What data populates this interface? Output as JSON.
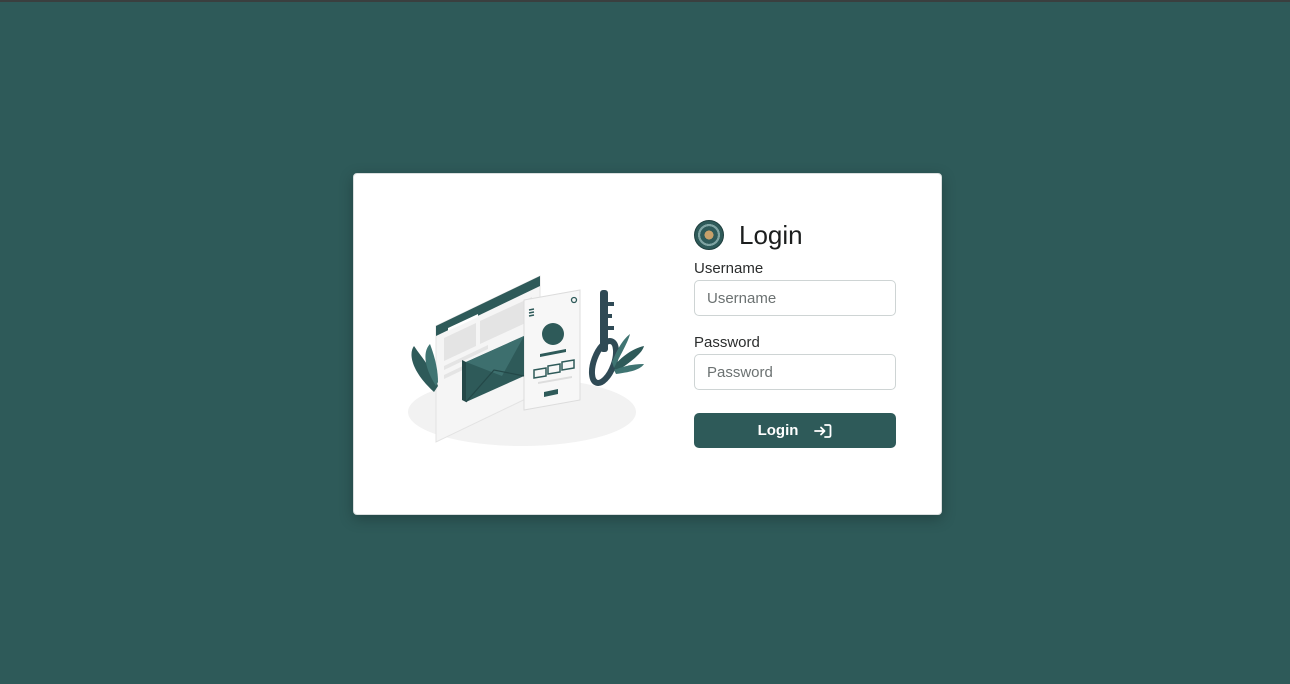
{
  "login_card": {
    "title": "Login",
    "logo_icon": "emblem-logo",
    "username": {
      "label": "Username",
      "placeholder": "Username",
      "value": ""
    },
    "password": {
      "label": "Password",
      "placeholder": "Password",
      "value": ""
    },
    "submit": {
      "label": "Login",
      "icon": "sign-in-icon"
    },
    "illustration": "login-illustration"
  },
  "colors": {
    "background": "#2e5a59",
    "accent": "#2e5a59",
    "card": "#ffffff"
  }
}
